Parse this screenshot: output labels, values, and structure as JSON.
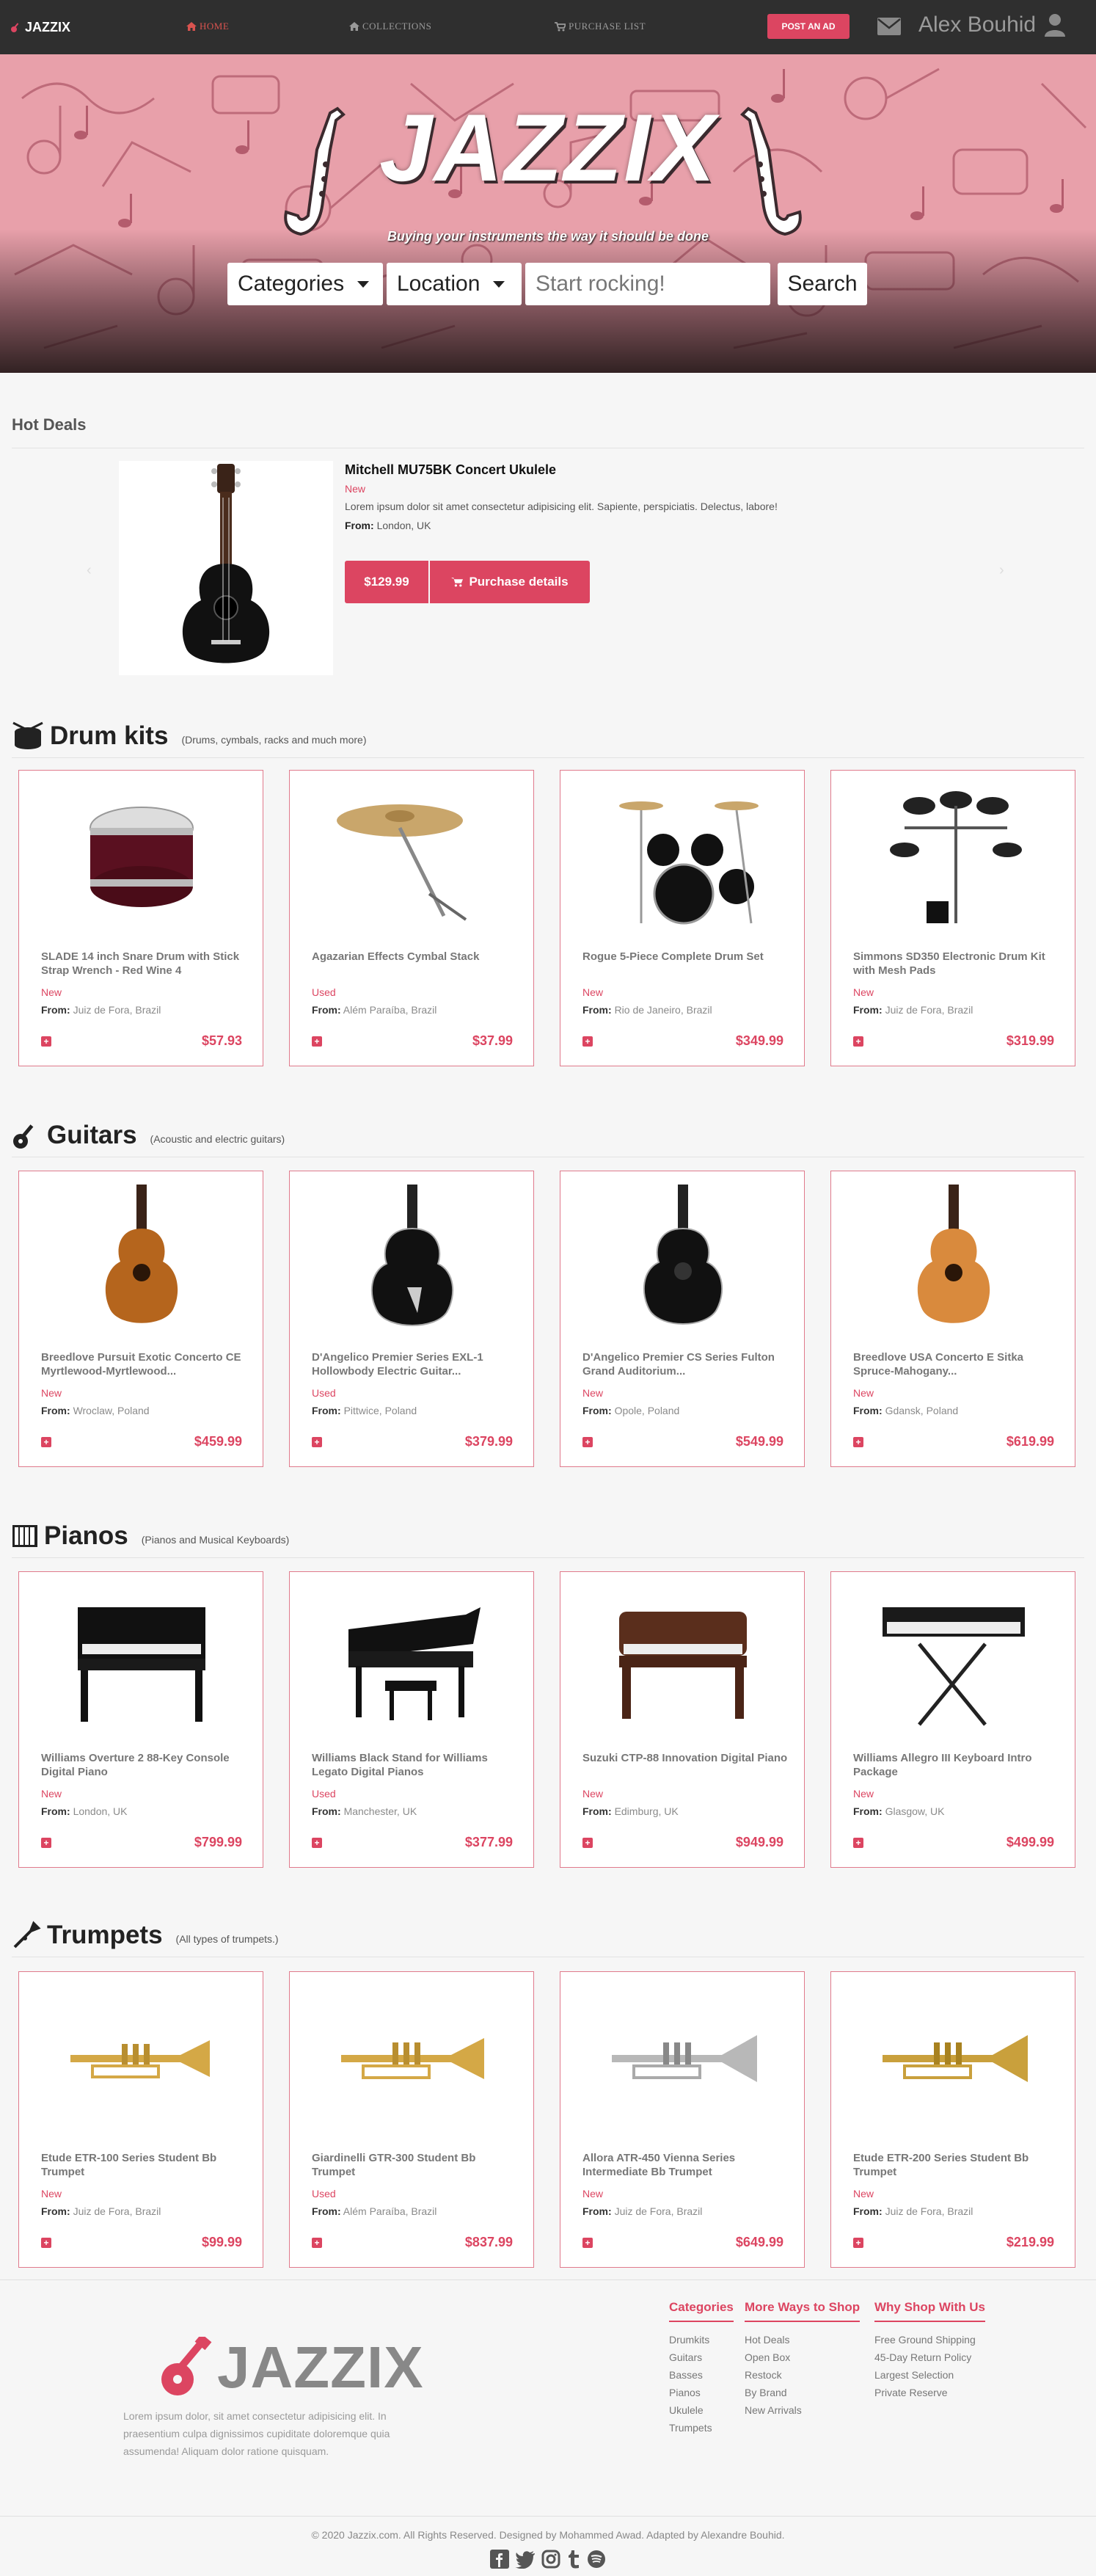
{
  "nav": {
    "brand": "JAZZIX",
    "links": [
      "HOME",
      "COLLECTIONS",
      "PURCHASE LIST"
    ],
    "post_ad": "POST AN AD",
    "user": "Alex Bouhid"
  },
  "hero": {
    "title": "JAZZIX",
    "subtitle": "Buying your instruments the way it should be done",
    "categories": "Categories",
    "location": "Location",
    "search_placeholder": "Start rocking!",
    "search_button": "Search"
  },
  "hot_deals": {
    "title": "Hot Deals",
    "name": "Mitchell MU75BK Concert Ukulele",
    "condition": "New",
    "description": "Lorem ipsum dolor sit amet consectetur adipisicing elit. Sapiente, perspiciatis. Delectus, labore!",
    "from_label": "From:",
    "from": "London, UK",
    "price": "$129.99",
    "purchase": "Purchase details"
  },
  "sections": [
    {
      "title": "Drum kits",
      "subtitle": "(Drums, cymbals, racks and much more)",
      "items": [
        {
          "name": "SLADE 14 inch Snare Drum with Stick Strap Wrench - Red Wine 4",
          "condition": "New",
          "from": "Juiz de Fora, Brazil",
          "price": "$57.93"
        },
        {
          "name": "Agazarian Effects Cymbal Stack",
          "condition": "Used",
          "from": "Além Paraíba, Brazil",
          "price": "$37.99"
        },
        {
          "name": "Rogue 5-Piece Complete Drum Set",
          "condition": "New",
          "from": "Rio de Janeiro, Brazil",
          "price": "$349.99"
        },
        {
          "name": "Simmons SD350 Electronic Drum Kit with Mesh Pads",
          "condition": "New",
          "from": "Juiz de Fora, Brazil",
          "price": "$319.99"
        }
      ]
    },
    {
      "title": "Guitars",
      "subtitle": "(Acoustic and electric guitars)",
      "items": [
        {
          "name": "Breedlove Pursuit Exotic Concerto CE Myrtlewood-Myrtlewood...",
          "condition": "New",
          "from": "Wroclaw, Poland",
          "price": "$459.99"
        },
        {
          "name": "D'Angelico Premier Series EXL-1 Hollowbody Electric Guitar...",
          "condition": "Used",
          "from": "Pittwice, Poland",
          "price": "$379.99"
        },
        {
          "name": "D'Angelico Premier CS Series Fulton Grand Auditorium...",
          "condition": "New",
          "from": "Opole, Poland",
          "price": "$549.99"
        },
        {
          "name": "Breedlove USA Concerto E Sitka Spruce-Mahogany...",
          "condition": "New",
          "from": "Gdansk, Poland",
          "price": "$619.99"
        }
      ]
    },
    {
      "title": "Pianos",
      "subtitle": "(Pianos and Musical Keyboards)",
      "items": [
        {
          "name": "Williams Overture 2 88-Key Console Digital Piano",
          "condition": "New",
          "from": "London, UK",
          "price": "$799.99"
        },
        {
          "name": "Williams Black Stand for Williams Legato Digital Pianos",
          "condition": "Used",
          "from": "Manchester, UK",
          "price": "$377.99"
        },
        {
          "name": "Suzuki CTP-88 Innovation Digital Piano",
          "condition": "New",
          "from": "Edimburg, UK",
          "price": "$949.99"
        },
        {
          "name": "Williams Allegro III Keyboard Intro Package",
          "condition": "New",
          "from": "Glasgow, UK",
          "price": "$499.99"
        }
      ]
    },
    {
      "title": "Trumpets",
      "subtitle": "(All types of trumpets.)",
      "items": [
        {
          "name": "Etude ETR-100 Series Student Bb Trumpet",
          "condition": "New",
          "from": "Juiz de Fora, Brazil",
          "price": "$99.99"
        },
        {
          "name": "Giardinelli GTR-300 Student Bb Trumpet",
          "condition": "Used",
          "from": "Além Paraíba, Brazil",
          "price": "$837.99"
        },
        {
          "name": "Allora ATR-450 Vienna Series Intermediate Bb Trumpet",
          "condition": "New",
          "from": "Juiz de Fora, Brazil",
          "price": "$649.99"
        },
        {
          "name": "Etude ETR-200 Series Student Bb Trumpet",
          "condition": "New",
          "from": "Juiz de Fora, Brazil",
          "price": "$219.99"
        }
      ]
    }
  ],
  "card_from_label": "From:",
  "footer": {
    "logo": "JAZZIX",
    "about": "Lorem ipsum dolor, sit amet consectetur adipisicing elit. In praesentium culpa dignissimos cupiditate doloremque quia assumenda! Aliquam dolor ratione quisquam.",
    "columns": [
      {
        "title": "Categories",
        "items": [
          "Drumkits",
          "Guitars",
          "Basses",
          "Pianos",
          "Ukulele",
          "Trumpets"
        ]
      },
      {
        "title": "More Ways to Shop",
        "items": [
          "Hot Deals",
          "Open Box",
          "Restock",
          "By Brand",
          "New Arrivals"
        ]
      },
      {
        "title": "Why Shop With Us",
        "items": [
          "Free Ground Shipping",
          "45-Day Return Policy",
          "Largest Selection",
          "Private Reserve"
        ]
      }
    ],
    "copyright": "© 2020 Jazzix.com. All Rights Reserved. Designed by Mohammed Awad. Adapted by Alexandre Bouhid."
  },
  "colors": {
    "accent": "#dc4561",
    "navbar": "#2f2f2f",
    "hero_pink": "#e8a0aa"
  }
}
